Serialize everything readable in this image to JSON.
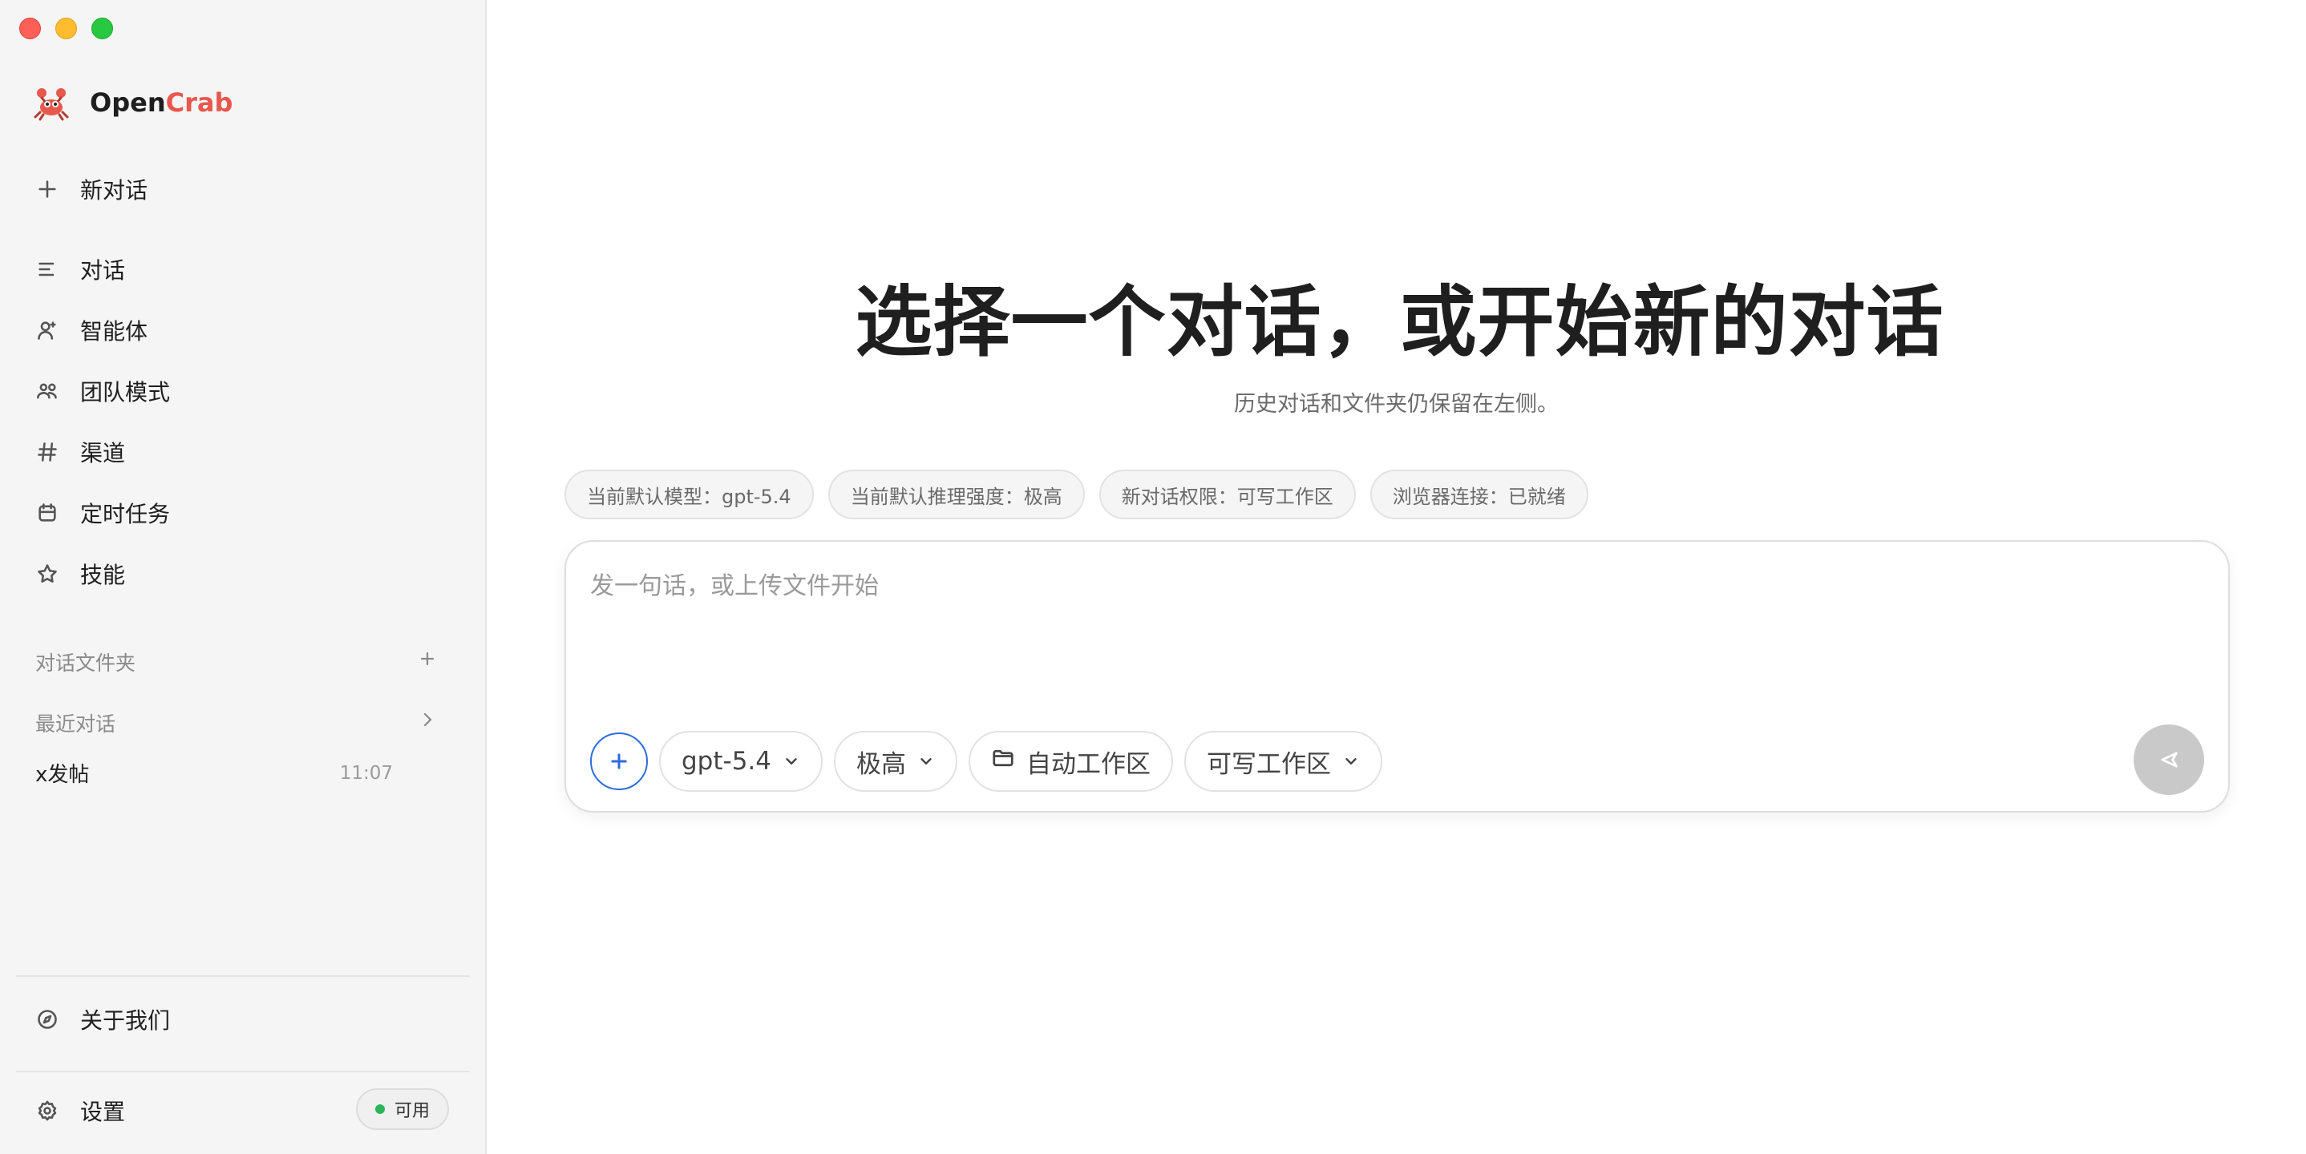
{
  "app": {
    "brand_prefix": "Open",
    "brand_accent": "Crab",
    "accent_color": "#e8584c"
  },
  "sidebar": {
    "new_chat": "新对话",
    "nav": [
      {
        "label": "对话",
        "icon": "lines-icon"
      },
      {
        "label": "智能体",
        "icon": "agent-icon"
      },
      {
        "label": "团队模式",
        "icon": "team-icon"
      },
      {
        "label": "渠道",
        "icon": "hash-icon"
      },
      {
        "label": "定时任务",
        "icon": "calendar-icon"
      },
      {
        "label": "技能",
        "icon": "star-icon"
      }
    ],
    "folders_label": "对话文件夹",
    "recent_label": "最近对话",
    "recent": [
      {
        "title": "x发帖",
        "time": "11:07"
      }
    ],
    "about": "关于我们",
    "settings": "设置",
    "status": {
      "label": "可用",
      "color": "#2ab55b"
    }
  },
  "main": {
    "headline": "选择一个对话，或开始新的对话",
    "subline": "历史对话和文件夹仍保留在左侧。",
    "chips": [
      "当前默认模型：gpt-5.4",
      "当前默认推理强度：极高",
      "新对话权限：可写工作区",
      "浏览器连接：已就绪"
    ],
    "composer": {
      "placeholder": "发一句话，或上传文件开始",
      "model": "gpt-5.4",
      "effort": "极高",
      "workspace": "自动工作区",
      "permission": "可写工作区"
    }
  }
}
